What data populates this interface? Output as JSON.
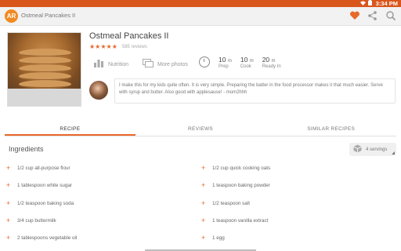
{
  "status_bar": {
    "time": "3:34 PM"
  },
  "app": {
    "logo_text": "AR",
    "title": "Ostmeal Pancakes II",
    "icons": [
      "heart-icon",
      "share-icon",
      "search-icon"
    ],
    "accent": "#e8682b"
  },
  "recipe": {
    "title": "Ostmeal Pancakes II",
    "rating_stars": "★★★★★",
    "reviews_count": "585 reviews",
    "nutrition_label": "Nutrition",
    "more_photos_label": "More photos",
    "prep_value": "10",
    "prep_unit": "m",
    "prep_label": "Prep",
    "cook_value": "10",
    "cook_unit": "m",
    "cook_label": "Cook",
    "ready_value": "20",
    "ready_unit": "m",
    "ready_label": "Ready In",
    "comment": "I make this for my kids quite often. It is very simple. Preparing the batter in the food processor makes it that much easier. Serve with syrup and butter. Also good with applesause! - mom2hhh"
  },
  "tabs": [
    "RECIPE",
    "REVIEWS",
    "SIMILAR RECIPES"
  ],
  "ingredients": {
    "title": "Ingredients",
    "servings": "4 servings",
    "left": [
      "1/2 cup all-purpose flour",
      "1 tablespoon white sugar",
      "1/2 teaspoon baking soda",
      "3/4 cup buttermilk",
      "2 tablespoons vegetable oil"
    ],
    "right": [
      "1/2 cup quick cooking oats",
      "1 teaspoon baking powder",
      "1/2 teaspoon salt",
      "1 teaspoon vanilla extract",
      "1 egg"
    ]
  }
}
